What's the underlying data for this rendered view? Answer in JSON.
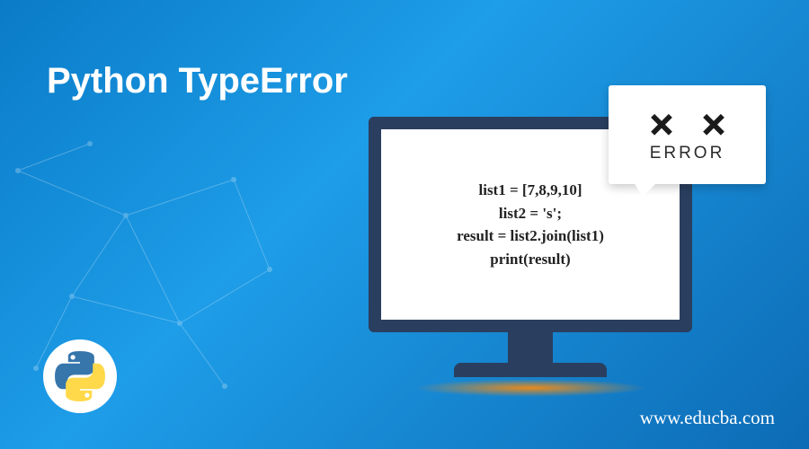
{
  "title": "Python TypeError",
  "code": {
    "line1": "list1 = [7,8,9,10]",
    "line2": "list2 = 's';",
    "line3": "result = list2.join(list1)",
    "line4": "print(result)"
  },
  "error_label": "ERROR",
  "watermark": "www.educba.com",
  "colors": {
    "bg_start": "#0a7bc7",
    "bg_end": "#0d6bb5",
    "monitor_frame": "#2a3f5f",
    "shadow": "#e88a1c",
    "python_blue": "#3776ab",
    "python_yellow": "#ffd94a"
  },
  "icons": {
    "python": "python-logo-icon",
    "error_x": "x-icon"
  }
}
